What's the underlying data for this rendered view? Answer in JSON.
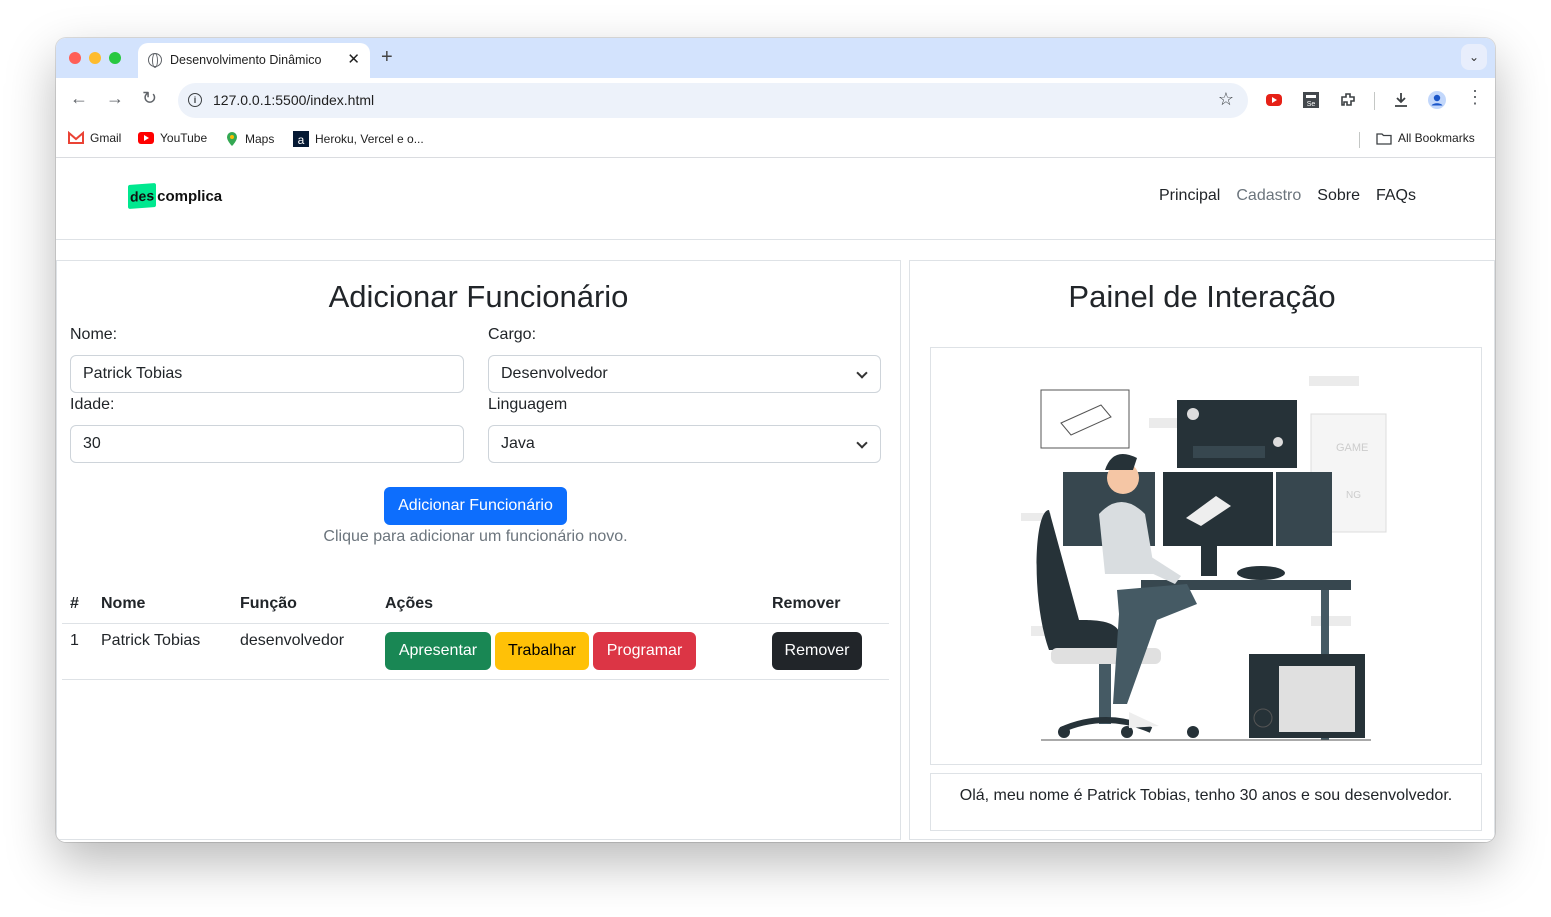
{
  "browser": {
    "tab_title": "Desenvolvimento Dinâmico",
    "url": "127.0.0.1:5500/index.html",
    "bookmarks": [
      "Gmail",
      "YouTube",
      "Maps",
      "Heroku, Vercel e o..."
    ],
    "all_bookmarks": "All Bookmarks"
  },
  "nav": {
    "logo_des": "des",
    "logo_rest": "complica",
    "links": [
      "Principal",
      "Cadastro",
      "Sobre",
      "FAQs"
    ],
    "active_link": "Cadastro"
  },
  "form": {
    "title": "Adicionar Funcionário",
    "name_label": "Nome:",
    "name_value": "Patrick Tobias",
    "role_label": "Cargo:",
    "role_value": "Desenvolvedor",
    "age_label": "Idade:",
    "age_value": "30",
    "language_label": "Linguagem",
    "language_value": "Java",
    "submit_label": "Adicionar Funcionário",
    "hint": "Clique para adicionar um funcionário novo."
  },
  "table": {
    "headers": [
      "#",
      "Nome",
      "Função",
      "Ações",
      "Remover"
    ],
    "rows": [
      {
        "index": "1",
        "name": "Patrick Tobias",
        "function": "desenvolvedor",
        "actions": [
          "Apresentar",
          "Trabalhar",
          "Programar"
        ],
        "remove": "Remover"
      }
    ]
  },
  "panel": {
    "title": "Painel de Interação",
    "message": "Olá, meu nome é Patrick Tobias, tenho 30 anos e sou desenvolvedor.",
    "illustration_text": [
      "GAME",
      "NG"
    ]
  },
  "colors": {
    "primary": "#0d6efd",
    "success": "#198754",
    "warning": "#ffc107",
    "danger": "#dc3545",
    "dark": "#212529",
    "logo_green": "#00e88f"
  }
}
